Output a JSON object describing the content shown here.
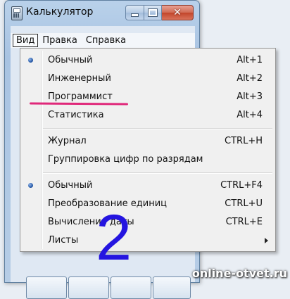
{
  "window": {
    "title": "Калькулятор",
    "close_glyph": "✕"
  },
  "menubar": [
    {
      "label": "Вид",
      "active": true
    },
    {
      "label": "Правка",
      "active": false
    },
    {
      "label": "Справка",
      "active": false
    }
  ],
  "view_menu": {
    "items": [
      {
        "label": "Обычный",
        "shortcut": "Alt+1",
        "checked": true
      },
      {
        "label": "Инженерный",
        "shortcut": "Alt+2",
        "checked": false
      },
      {
        "label": "Программист",
        "shortcut": "Alt+3",
        "checked": false
      },
      {
        "label": "Статистика",
        "shortcut": "Alt+4",
        "checked": false
      },
      {
        "label": "Журнал",
        "shortcut": "CTRL+H",
        "checked": false
      },
      {
        "label": "Группировка цифр по разрядам",
        "shortcut": "",
        "checked": false
      },
      {
        "label": "Обычный",
        "shortcut": "CTRL+F4",
        "checked": true
      },
      {
        "label": "Преобразование единиц",
        "shortcut": "CTRL+U",
        "checked": false
      },
      {
        "label": "Вычисление даты",
        "shortcut": "CTRL+E",
        "checked": false
      },
      {
        "label": "Листы",
        "shortcut": "",
        "submenu": true
      }
    ]
  },
  "annotation": {
    "number": "2",
    "underline_color": "#e0287a",
    "number_color": "#2414e0"
  },
  "watermark": "online-otvet.ru"
}
